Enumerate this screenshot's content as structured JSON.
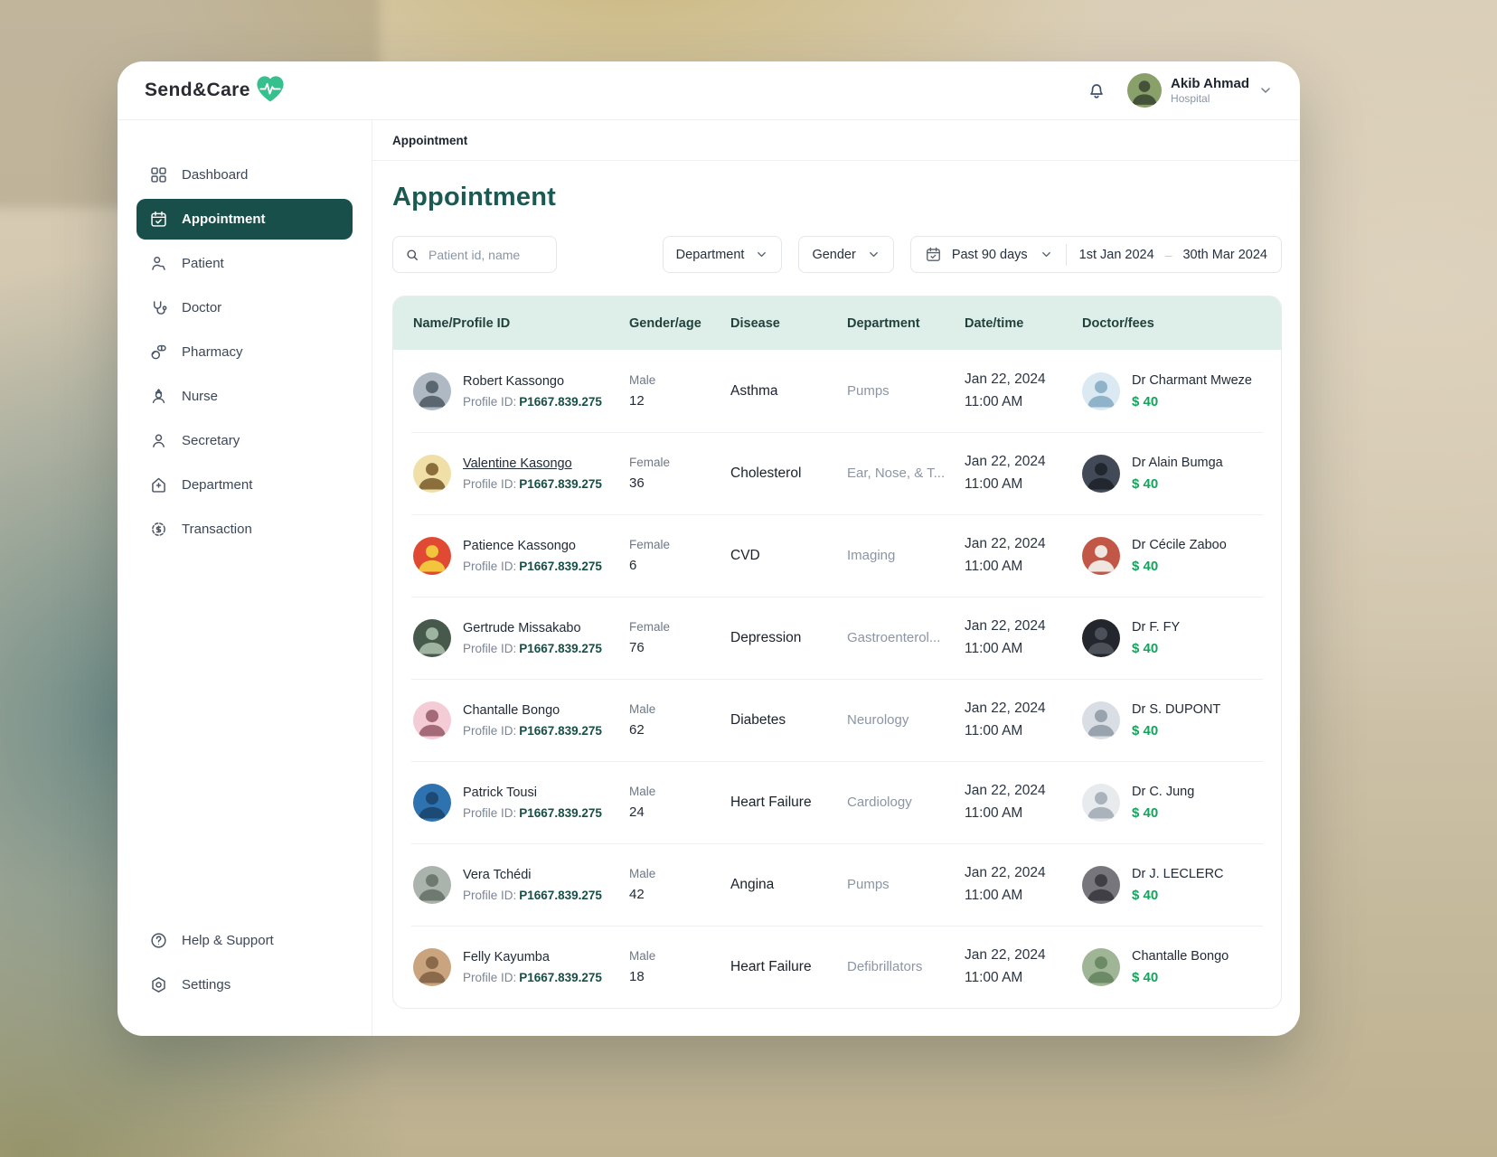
{
  "app": {
    "brand": "Send&Care"
  },
  "header": {
    "user_name": "Akib Ahmad",
    "user_role": "Hospital"
  },
  "sidebar": {
    "items": [
      {
        "id": "dashboard",
        "label": "Dashboard",
        "icon": "dashboard-icon",
        "active": false
      },
      {
        "id": "appointment",
        "label": "Appointment",
        "icon": "calendar-check-icon",
        "active": true
      },
      {
        "id": "patient",
        "label": "Patient",
        "icon": "patient-icon",
        "active": false
      },
      {
        "id": "doctor",
        "label": "Doctor",
        "icon": "stethoscope-icon",
        "active": false
      },
      {
        "id": "pharmacy",
        "label": "Pharmacy",
        "icon": "pills-icon",
        "active": false
      },
      {
        "id": "nurse",
        "label": "Nurse",
        "icon": "nurse-icon",
        "active": false
      },
      {
        "id": "secretary",
        "label": "Secretary",
        "icon": "person-icon",
        "active": false
      },
      {
        "id": "department",
        "label": "Department",
        "icon": "building-icon",
        "active": false
      },
      {
        "id": "transaction",
        "label": "Transaction",
        "icon": "coin-icon",
        "active": false
      }
    ],
    "footer_items": [
      {
        "id": "help",
        "label": "Help & Support",
        "icon": "help-icon"
      },
      {
        "id": "settings",
        "label": "Settings",
        "icon": "settings-icon"
      }
    ]
  },
  "breadcrumb": "Appointment",
  "page_title": "Appointment",
  "filters": {
    "search_placeholder": "Patient id, name",
    "department_label": "Department",
    "gender_label": "Gender",
    "range_preset": "Past 90 days",
    "date_from": "1st Jan 2024",
    "date_separator": "–",
    "date_to": "30th Mar 2024"
  },
  "table": {
    "columns": [
      "Name/Profile ID",
      "Gender/age",
      "Disease",
      "Department",
      "Date/time",
      "Doctor/fees"
    ],
    "profile_id_label": "Profile ID:",
    "rows": [
      {
        "name": "Robert Kassongo",
        "name_underlined": false,
        "profile_id": "P1667.839.275",
        "gender": "Male",
        "age": "12",
        "disease": "Asthma",
        "department": "Pumps",
        "date": "Jan 22, 2024",
        "time": "11:00 AM",
        "doctor": "Dr Charmant Mweze",
        "fee": "$ 40",
        "avatar": {
          "bg": "#aeb9c4",
          "fg": "#5b6770"
        },
        "doctor_avatar": {
          "bg": "#dbe9f2",
          "fg": "#8fb4c9"
        }
      },
      {
        "name": "Valentine Kasongo",
        "name_underlined": true,
        "profile_id": "P1667.839.275",
        "gender": "Female",
        "age": "36",
        "disease": "Cholesterol",
        "department": "Ear, Nose, & T...",
        "date": "Jan 22, 2024",
        "time": "11:00 AM",
        "doctor": "Dr Alain Bumga",
        "fee": "$ 40",
        "avatar": {
          "bg": "#f0e0a8",
          "fg": "#8a6f3c"
        },
        "doctor_avatar": {
          "bg": "#434a57",
          "fg": "#21262f"
        }
      },
      {
        "name": "Patience Kassongo",
        "name_underlined": false,
        "profile_id": "P1667.839.275",
        "gender": "Female",
        "age": "6",
        "disease": "CVD",
        "department": "Imaging",
        "date": "Jan 22, 2024",
        "time": "11:00 AM",
        "doctor": "Dr Cécile Zaboo",
        "fee": "$ 40",
        "avatar": {
          "bg": "#e04a33",
          "fg": "#f3c53d"
        },
        "doctor_avatar": {
          "bg": "#c25747",
          "fg": "#f0e6e0"
        }
      },
      {
        "name": "Gertrude Missakabo",
        "name_underlined": false,
        "profile_id": "P1667.839.275",
        "gender": "Female",
        "age": "76",
        "disease": "Depression",
        "department": "Gastroenterol...",
        "date": "Jan 22, 2024",
        "time": "11:00 AM",
        "doctor": "Dr F. FY",
        "fee": "$ 40",
        "avatar": {
          "bg": "#47594a",
          "fg": "#9fb3a1"
        },
        "doctor_avatar": {
          "bg": "#23262c",
          "fg": "#4c5058"
        }
      },
      {
        "name": "Chantalle Bongo",
        "name_underlined": false,
        "profile_id": "P1667.839.275",
        "gender": "Male",
        "age": "62",
        "disease": "Diabetes",
        "department": "Neurology",
        "date": "Jan 22, 2024",
        "time": "11:00 AM",
        "doctor": "Dr S. DUPONT",
        "fee": "$ 40",
        "avatar": {
          "bg": "#f3ccd6",
          "fg": "#a56a77"
        },
        "doctor_avatar": {
          "bg": "#d9dee4",
          "fg": "#98a3ae"
        }
      },
      {
        "name": "Patrick Tousi",
        "name_underlined": false,
        "profile_id": "P1667.839.275",
        "gender": "Male",
        "age": "24",
        "disease": "Heart Failure",
        "department": "Cardiology",
        "date": "Jan 22, 2024",
        "time": "11:00 AM",
        "doctor": "Dr C. Jung",
        "fee": "$ 40",
        "avatar": {
          "bg": "#2e72b0",
          "fg": "#1c4a74"
        },
        "doctor_avatar": {
          "bg": "#e8ebee",
          "fg": "#aab3bc"
        }
      },
      {
        "name": "Vera Tchédi",
        "name_underlined": false,
        "profile_id": "P1667.839.275",
        "gender": "Male",
        "age": "42",
        "disease": "Angina",
        "department": "Pumps",
        "date": "Jan 22, 2024",
        "time": "11:00 AM",
        "doctor": "Dr J. LECLERC",
        "fee": "$ 40",
        "avatar": {
          "bg": "#aab4ac",
          "fg": "#6e7a70"
        },
        "doctor_avatar": {
          "bg": "#76767c",
          "fg": "#3f3f45"
        }
      },
      {
        "name": "Felly Kayumba",
        "name_underlined": false,
        "profile_id": "P1667.839.275",
        "gender": "Male",
        "age": "18",
        "disease": "Heart Failure",
        "department": "Defibrillators",
        "date": "Jan 22, 2024",
        "time": "11:00 AM",
        "doctor": "Chantalle Bongo",
        "fee": "$ 40",
        "avatar": {
          "bg": "#c9a47e",
          "fg": "#8a6a4a"
        },
        "doctor_avatar": {
          "bg": "#9fb596",
          "fg": "#6d8a66"
        }
      }
    ]
  },
  "colors": {
    "accent_teal": "#184F4B",
    "title_teal": "#1A5A52",
    "fee_green": "#14A45C",
    "header_mint": "#DDEFE8",
    "logo_green": "#35C08E"
  },
  "header_icons": {
    "user_avatar": {
      "bg": "#8aa06a",
      "fg": "#45523a"
    }
  }
}
